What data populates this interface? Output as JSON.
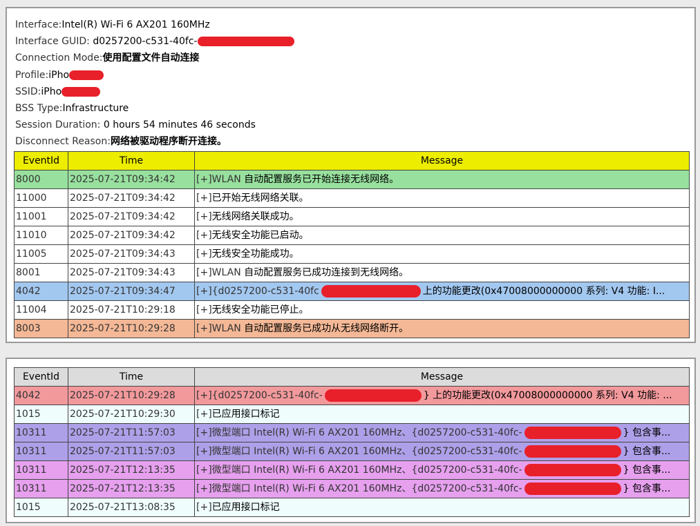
{
  "info": [
    {
      "label": "Interface:",
      "value": "Intel(R) Wi-Fi 6 AX201 160MHz",
      "bold": false
    },
    {
      "label": "Interface GUID: ",
      "value": "d0257200-c531-40fc-",
      "bold": false,
      "redacted": true
    },
    {
      "label": "Connection Mode:",
      "value": "使用配置文件自动连接",
      "bold": true
    },
    {
      "label": "Profile:",
      "value": "iPho",
      "bold": false,
      "redacted": true
    },
    {
      "label": "SSID:",
      "value": "iPho",
      "bold": false,
      "redacted": true
    },
    {
      "label": "BSS Type:",
      "value": "Infrastructure",
      "bold": false
    },
    {
      "label": "Session Duration: ",
      "value": "0 hours 54 minutes 46 seconds",
      "bold": false
    },
    {
      "label": "Disconnect Reason:",
      "value": "网络被驱动程序断开连接。",
      "bold": true
    }
  ],
  "headers": {
    "event_id": "EventId",
    "time": "Time",
    "message": "Message"
  },
  "table1": [
    {
      "id": "8000",
      "time": "2025-07-21T09:34:42",
      "prefix": "[+]WLAN ",
      "text": "自动配置服务已开始连接无线网络。",
      "color": "green"
    },
    {
      "id": "11000",
      "time": "2025-07-21T09:34:42",
      "prefix": "[+]",
      "text": "已开始无线网络关联。",
      "color": "white"
    },
    {
      "id": "11001",
      "time": "2025-07-21T09:34:42",
      "prefix": "[+]",
      "text": "无线网络关联成功。",
      "color": "white"
    },
    {
      "id": "11010",
      "time": "2025-07-21T09:34:42",
      "prefix": "[+]",
      "text": "无线安全功能已启动。",
      "color": "white"
    },
    {
      "id": "11005",
      "time": "2025-07-21T09:34:43",
      "prefix": "[+]",
      "text": "无线安全功能成功。",
      "color": "white"
    },
    {
      "id": "8001",
      "time": "2025-07-21T09:34:43",
      "prefix": "[+]WLAN ",
      "text": "自动配置服务已成功连接到无线网络。",
      "color": "white"
    },
    {
      "id": "4042",
      "time": "2025-07-21T09:34:47",
      "prefix": "[+]{d0257200-c531-40fc",
      "text": "上的功能更改(0x47008000000000 系列: V4 功能: I...",
      "color": "blue",
      "redacted": true
    },
    {
      "id": "11004",
      "time": "2025-07-21T10:29:18",
      "prefix": "[+]",
      "text": "无线安全功能已停止。",
      "color": "white"
    },
    {
      "id": "8003",
      "time": "2025-07-21T10:29:28",
      "prefix": "[+]WLAN ",
      "text": "自动配置服务已成功从无线网络断开。",
      "color": "orange"
    }
  ],
  "table2": [
    {
      "id": "4042",
      "time": "2025-07-21T10:29:28",
      "prefix": "[+]{d0257200-c531-40fc-",
      "text": "} 上的功能更改(0x47008000000000 系列: V4 功能: ...",
      "color": "red",
      "redacted": true
    },
    {
      "id": "1015",
      "time": "2025-07-21T10:29:30",
      "prefix": "[+]",
      "text": "已应用接口标记",
      "color": "lightcyan"
    },
    {
      "id": "10311",
      "time": "2025-07-21T11:57:03",
      "prefix": "[+]微型端口 Intel(R) Wi-Fi 6 AX201 160MHz、{d0257200-c531-40fc-",
      "text": "} 包含事...",
      "color": "purple",
      "redacted": true
    },
    {
      "id": "10311",
      "time": "2025-07-21T11:57:03",
      "prefix": "[+]微型端口 Intel(R) Wi-Fi 6 AX201 160MHz、{d0257200-c531-40fc-",
      "text": "} 包含事...",
      "color": "purple",
      "redacted": true
    },
    {
      "id": "10311",
      "time": "2025-07-21T12:13:35",
      "prefix": "[+]微型端口 Intel(R) Wi-Fi 6 AX201 160MHz、{d0257200-c531-40fc-",
      "text": "} 包含事...",
      "color": "pink",
      "redacted": true
    },
    {
      "id": "10311",
      "time": "2025-07-21T12:13:35",
      "prefix": "[+]微型端口 Intel(R) Wi-Fi 6 AX201 160MHz、{d0257200-c531-40fc-",
      "text": "} 包含事...",
      "color": "pink",
      "redacted": true
    },
    {
      "id": "1015",
      "time": "2025-07-21T13:08:35",
      "prefix": "[+]",
      "text": "已应用接口标记",
      "color": "lightcyan"
    }
  ],
  "colors": {
    "header_yellow": "#eded00",
    "header_gray": "#dcdcdc",
    "green": "#98e09e",
    "blue": "#a3c8f0",
    "orange": "#f4b896",
    "red": "#f2999c",
    "purple": "#aea0e8",
    "pink": "#e6a0ee",
    "lightcyan": "#effdfd",
    "redaction": "#e8202a"
  }
}
